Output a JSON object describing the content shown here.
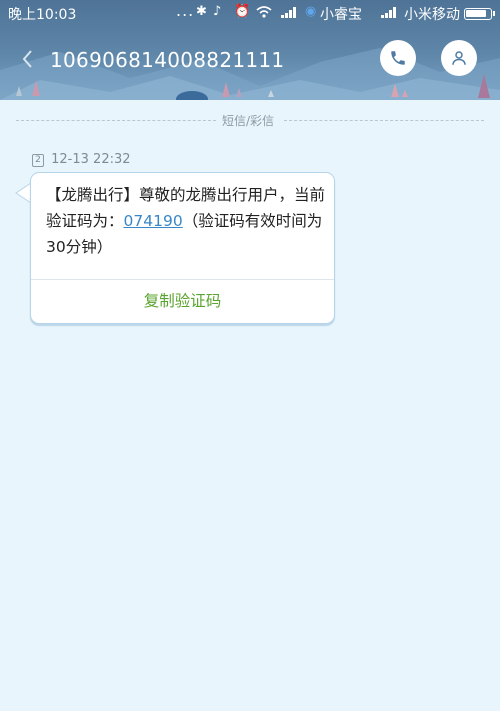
{
  "status_bar": {
    "time": "晚上10:03",
    "overflow": "...",
    "assistant_label": "小睿宝",
    "carrier": "小米移动",
    "battery_level": 0.85
  },
  "header": {
    "phone_number": "106906814008821111",
    "icons": [
      "back-arrow-icon",
      "phone-icon",
      "person-icon"
    ]
  },
  "divider": {
    "label": "短信/彩信"
  },
  "message": {
    "sim_slot": "2",
    "timestamp": "12-13 22:32",
    "text_before_code": "【龙腾出行】尊敬的龙腾出行用户，当前验证码为：",
    "code": "074190",
    "text_after_code": "（验证码有效时间为30分钟）",
    "copy_action": "复制验证码"
  },
  "colors": {
    "header_bg": "#5f87aa",
    "page_bg": "#e8f5fd",
    "link": "#3a87c8",
    "action_green": "#5aa42e"
  }
}
